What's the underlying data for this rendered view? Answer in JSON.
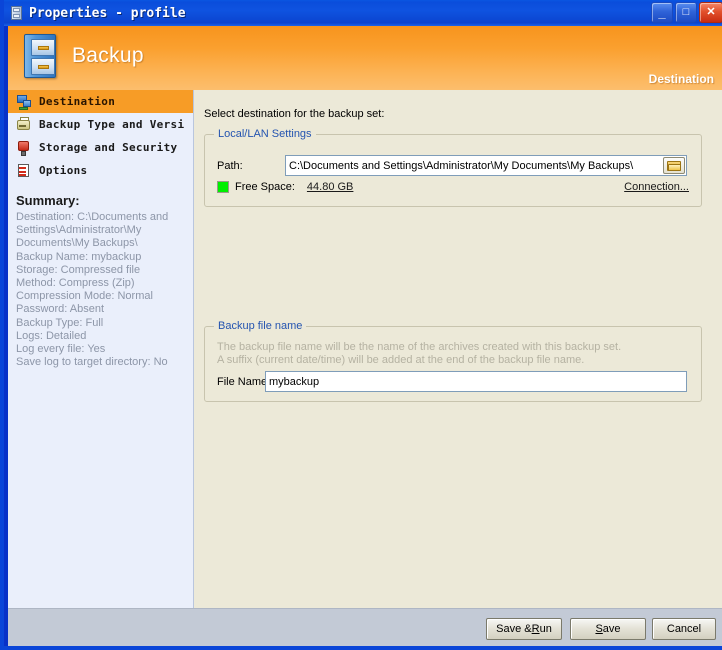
{
  "window": {
    "title": "Properties - profile",
    "icon": "cabinet-icon",
    "buttons": {
      "minimize": "_",
      "maximize": "□",
      "close": "✕"
    }
  },
  "banner": {
    "title": "Backup",
    "section": "Destination",
    "icon": "filing-cabinet-icon",
    "color_start": "#f7941d",
    "color_end": "#fcbe6d"
  },
  "sidebar": {
    "items": [
      {
        "label": "Destination",
        "icon": "network-destination-icon",
        "selected": true
      },
      {
        "label": "Backup Type and Versi",
        "icon": "backup-type-icon",
        "selected": false
      },
      {
        "label": "Storage and Security",
        "icon": "storage-security-icon",
        "selected": false
      },
      {
        "label": "Options",
        "icon": "options-checklist-icon",
        "selected": false
      }
    ],
    "selected_color": "#f79c26",
    "summary": {
      "title": "Summary:",
      "lines": [
        "Destination: C:\\Documents and Settings\\Administrator\\My Documents\\My Backups\\",
        "Backup Name: mybackup",
        "Storage: Compressed file",
        "Method: Compress (Zip)",
        "Compression Mode: Normal",
        "Password: Absent",
        "Backup Type: Full",
        "Logs: Detailed",
        "Log every file: Yes",
        "Save log to target directory: No"
      ]
    }
  },
  "main": {
    "intro": "Select destination for the backup set:",
    "lan_group": {
      "legend": "Local/LAN Settings",
      "path_label": "Path:",
      "path_value": "C:\\Documents and Settings\\Administrator\\My Documents\\My Backups\\",
      "browse_icon": "folder-open-icon",
      "free_space_label": "Free Space:",
      "free_space_value": "44.80 GB",
      "free_space_indicator_color": "#00f000",
      "connection_link": "Connection..."
    },
    "file_group": {
      "legend": "Backup file name",
      "help_line1": "The backup file name will be the name of the archives created with this backup set.",
      "help_line2": "A suffix (current date/time) will be added at the end of the backup file name.",
      "file_label": "File Name:",
      "file_value": "mybackup"
    }
  },
  "footer": {
    "save_run": {
      "pre": "Save & ",
      "accel": "R",
      "post": "un"
    },
    "save": {
      "pre": "",
      "accel": "S",
      "post": "ave"
    },
    "cancel": "Cancel"
  }
}
